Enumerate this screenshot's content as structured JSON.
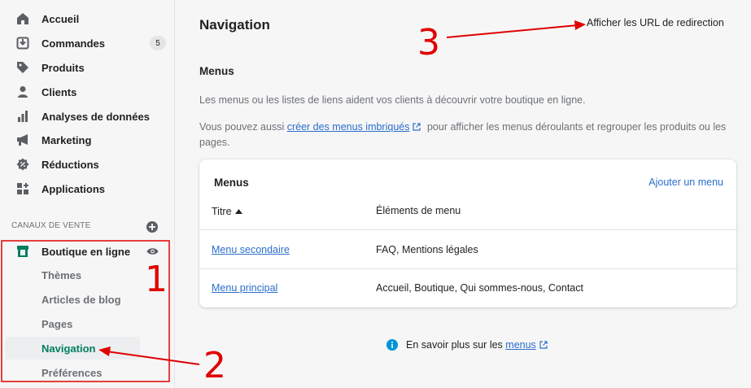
{
  "sidebar": {
    "items": [
      {
        "label": "Accueil",
        "icon": "home-icon"
      },
      {
        "label": "Commandes",
        "icon": "orders-icon",
        "badge": "5"
      },
      {
        "label": "Produits",
        "icon": "tag-icon"
      },
      {
        "label": "Clients",
        "icon": "person-icon"
      },
      {
        "label": "Analyses de données",
        "icon": "bar-chart-icon"
      },
      {
        "label": "Marketing",
        "icon": "megaphone-icon"
      },
      {
        "label": "Réductions",
        "icon": "discount-icon"
      },
      {
        "label": "Applications",
        "icon": "apps-icon"
      }
    ],
    "sales_channels_title": "CANAUX DE VENTE",
    "online_store": {
      "label": "Boutique en ligne",
      "sub_items": [
        "Thèmes",
        "Articles de blog",
        "Pages",
        "Navigation",
        "Préférences"
      ],
      "active": "Navigation"
    }
  },
  "main": {
    "title": "Navigation",
    "redirect_link": "Afficher les URL de redirection",
    "section_heading": "Menus",
    "desc1": "Les menus ou les listes de liens aident vos clients à découvrir votre boutique en ligne.",
    "desc2_before": "Vous pouvez aussi ",
    "desc2_link": "créer des menus imbriqués",
    "desc2_after": " pour afficher les menus déroulants et regrouper les produits ou les pages.",
    "card": {
      "title": "Menus",
      "action": "Ajouter un menu",
      "columns": [
        "Titre",
        "Éléments de menu"
      ],
      "rows": [
        {
          "title": "Menu secondaire",
          "items": "FAQ, Mentions légales"
        },
        {
          "title": "Menu principal",
          "items": "Accueil, Boutique, Qui sommes-nous, Contact"
        }
      ]
    },
    "info_before": "En savoir plus sur les ",
    "info_link": "menus"
  },
  "annotations": [
    "1",
    "2",
    "3"
  ],
  "colors": {
    "accent_green": "#007f5f",
    "link_blue": "#2c6ecb",
    "annotation_red": "#e00000"
  }
}
